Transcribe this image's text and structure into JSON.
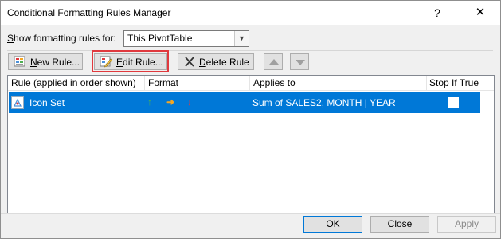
{
  "window": {
    "title": "Conditional Formatting Rules Manager",
    "help_glyph": "?",
    "close_glyph": "✕"
  },
  "filter": {
    "label_prefix": "",
    "label_access": "S",
    "label_rest": "how formatting rules for:",
    "selected": "This PivotTable"
  },
  "toolbar": {
    "new_access": "N",
    "new_rest": "ew Rule...",
    "edit_access": "E",
    "edit_rest": "dit Rule...",
    "delete_access": "D",
    "delete_rest": "elete Rule"
  },
  "columns": {
    "rule": "Rule (applied in order shown)",
    "format": "Format",
    "applies": "Applies to",
    "stop": "Stop If True"
  },
  "rows": [
    {
      "rule": "Icon Set",
      "format_icons": [
        "↑",
        "➜",
        "↓"
      ],
      "format_colors": [
        "#4caf50",
        "#f5a623",
        "#e0393e"
      ],
      "applies_to": "Sum of SALES2, MONTH | YEAR",
      "stop_if_true": false
    }
  ],
  "buttons": {
    "ok": "OK",
    "cancel": "Close",
    "apply": "Apply"
  }
}
